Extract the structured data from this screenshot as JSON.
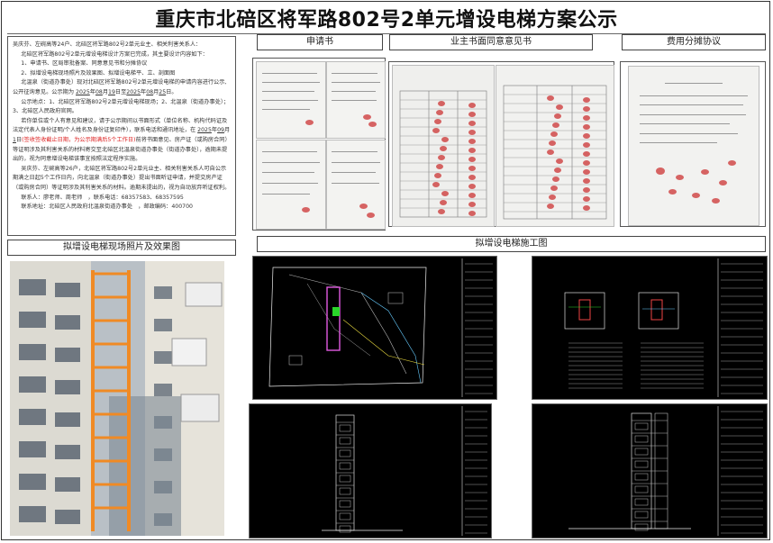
{
  "title": "重庆市北碚区将军路802号2单元增设电梯方案公示",
  "notice": {
    "salutation": "吴庆芬、左碗高等24户、北碚区将军路802号2单元业主、相关利害关系人：",
    "intro": "北碚区将军路802号2单元增设电梯设计方案已完成，其主要设计内容如下：",
    "item1": "1、申请书、区局审批备案、同意意见书和分摊协议",
    "item2": "2、拟增设电梯现场照片及效果图、拟增设电梯平、立、剖面图",
    "p1": "北温泉（街道办事处）现对北碚区将军路802号2单元增设电梯的申请内容进行公示,公开征询意见。公示期为",
    "date_y1": "2025",
    "date_m1": "08",
    "date_d1": "19",
    "date_y2": "2025",
    "date_m2": "08",
    "date_d2": "25",
    "venue": "公示地点：1、北碚区将军路802号2单元增设电梯现场；2、北温泉（街道办事处）；3、北碚区人民政府官网。",
    "p2a": "若你单位或个人有意见和建议，请于公示期间以书面形式（单位名称、机构代码证及法定代表人身份证明/个人姓名及身份证复印件），联系电话和通讯地址，在",
    "date_y3": "2025",
    "date_m3": "09",
    "date_d3": "1",
    "red_note": "(签收签收截止日期，为公示期满后5个工作日)",
    "p2b": "前将书面意见、房产证（或购房合同）等证明涉及其利害关系的材料寄交至北碚区北温泉街道办事处（街道办事处），逾期未提出的，视为同意增设电梯该事宜按照法定程序实施。",
    "p3": "吴庆芬、左碗高等26户，北碚区将军路802号2单元业主、相关利害关系人可自公示期满之日起5个工作日内，向北温泉（街道办事处）提出书面听证申请，并提交房产证（或购房合同）等证明涉及其利害关系的材料。逾期未提出的，视为自动放弃听证权利。",
    "contact_label": "联系人：",
    "contact_names": "廖老师、周老师",
    "phone_label": "联系电话：",
    "phones": "68357583、68357595",
    "address_label": "联系地址：",
    "address": "北碚区人民政府北温泉街道办事处",
    "postcode_label": "邮政编码：",
    "postcode": "400700"
  },
  "sections": {
    "application": "申请书",
    "consent": "业主书面同意意见书",
    "cost": "费用分摊协议",
    "photos": "拟增设电梯现场照片及效果图",
    "drawings": "拟增设电梯施工图"
  },
  "colors": {
    "accent_red": "#d22222",
    "cad_bg": "#000000",
    "elevator_orange": "#f08a24"
  }
}
